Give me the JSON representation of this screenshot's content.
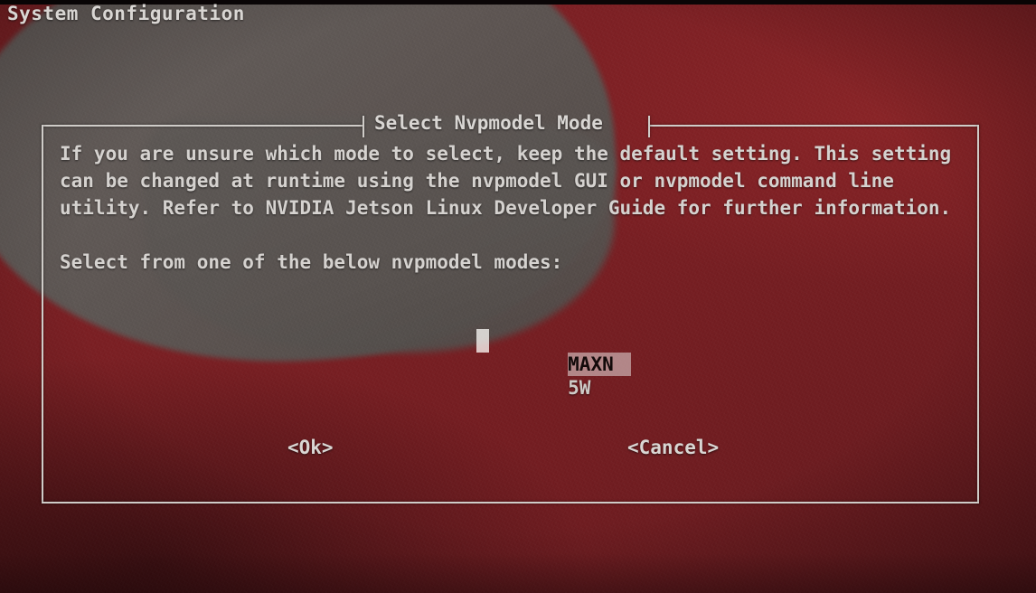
{
  "screen": {
    "title": "System Configuration",
    "background_color": "#7c2024",
    "blob_color": "#5c5754",
    "text_color": "#d9d6d3"
  },
  "dialog": {
    "title": "Select Nvpmodel Mode",
    "border_color": "#cfccc8",
    "body": {
      "paragraph1": "If you are unsure which mode to select, keep the default setting. This setting can be changed at runtime using the nvpmodel GUI or nvpmodel command line utility. Refer to NVIDIA Jetson Linux Developer Guide for further information.",
      "paragraph2": "Select from one of the below nvpmodel modes:"
    },
    "mode_list": {
      "selected_index": 0,
      "highlight_color": "#a08d8d",
      "cursor_color": "#f0eeea",
      "items": [
        {
          "label": "MAXN",
          "selected": true
        },
        {
          "label": "5W",
          "selected": false
        }
      ]
    },
    "buttons": {
      "ok": "<Ok>",
      "cancel": "<Cancel>"
    }
  }
}
